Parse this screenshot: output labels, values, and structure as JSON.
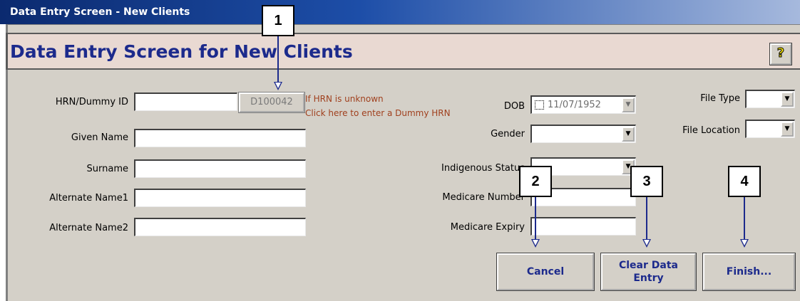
{
  "window": {
    "title": "Data Entry Screen - New Clients"
  },
  "header": {
    "heading": "Data Entry Screen for New Clients",
    "help_icon": "?"
  },
  "form": {
    "hrn_label": "HRN/Dummy ID",
    "hrn_value": "",
    "dummy_button": "D100042",
    "hint_line1": "If HRN is unknown",
    "hint_line2": "Click here to enter a Dummy HRN",
    "given_name_label": "Given Name",
    "surname_label": "Surname",
    "alt1_label": "Alternate Name1",
    "alt2_label": "Alternate Name2",
    "dob_label": "DOB",
    "dob_value": "11/07/1952",
    "gender_label": "Gender",
    "indigenous_label": "Indigenous Status",
    "medicare_number_label": "Medicare Number",
    "medicare_expiry_label": "Medicare Expiry",
    "file_type_label": "File Type",
    "file_location_label": "File Location"
  },
  "buttons": {
    "cancel": "Cancel",
    "clear_line1": "Clear Data",
    "clear_line2": "Entry",
    "finish": "Finish..."
  },
  "callouts": {
    "c1": "1",
    "c2": "2",
    "c3": "3",
    "c4": "4"
  },
  "colors": {
    "heading": "#1c2a8c",
    "hint": "#a0401e",
    "face": "#d4d0c8"
  }
}
